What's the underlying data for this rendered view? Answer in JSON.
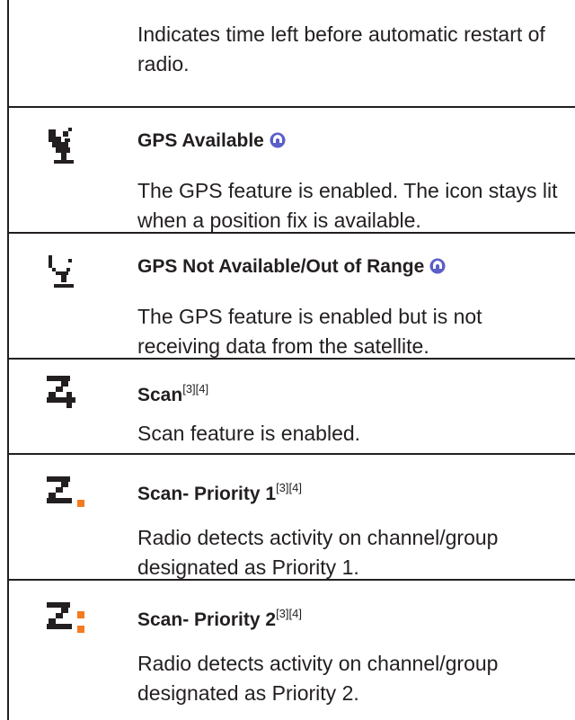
{
  "rows": [
    {
      "desc": "Indicates time left before automatic restart of radio."
    },
    {
      "icon": "gps-available-icon",
      "title": "GPS Available",
      "desc": "The GPS feature is enabled. The icon stays lit when a position fix is available."
    },
    {
      "icon": "gps-not-available-icon",
      "title": "GPS Not Available/Out of Range",
      "desc": "The GPS feature is enabled but is not receiving data from the satellite."
    },
    {
      "icon": "scan-icon",
      "title": "Scan",
      "sup": "[3][4]",
      "desc": "Scan feature is enabled."
    },
    {
      "icon": "scan-priority-1-icon",
      "title": "Scan- Priority 1",
      "sup": "[3][4]",
      "desc": "Radio detects activity on channel/group designated as Priority 1."
    },
    {
      "icon": "scan-priority-2-icon",
      "title": "Scan- Priority 2",
      "sup": "[3][4]",
      "desc": "Radio detects activity on channel/group designated as Priority 2."
    }
  ],
  "colors": {
    "text": "#231f20",
    "priority": "#f47b20",
    "badge": "#5b5fc7"
  }
}
